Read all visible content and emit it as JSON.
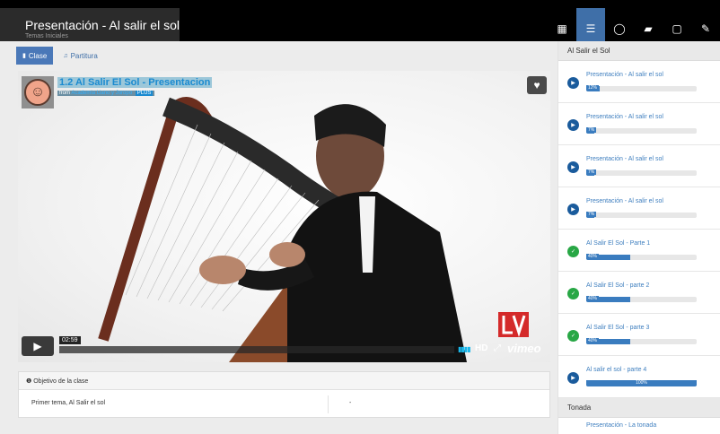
{
  "app": {
    "title": "Presentación - Al salir el sol",
    "subtitle": "Temas Iniciales"
  },
  "toolbar": {
    "icons": [
      "grid-icon",
      "list-icon",
      "chat-icon",
      "folder-icon",
      "note-icon",
      "wrench-icon"
    ],
    "active": "list-icon"
  },
  "tabs": [
    {
      "label": "Clase",
      "icon": "bookmark-icon",
      "active": true
    },
    {
      "label": "Partitura",
      "icon": "music-note-icon",
      "active": false
    }
  ],
  "video": {
    "title": "1.2 Al Salir El Sol - Presentacion",
    "from_prefix": "from",
    "channel": "Academia Llano y Joropo",
    "badge": "PLUS",
    "time": "02:59",
    "hd_label": "HD",
    "provider": "vimeo",
    "colors": {
      "accent": "#1ab7ea",
      "title": "#1a8ad0"
    }
  },
  "objective": {
    "heading": "Objetivo de la clase",
    "row_text": "Primer tema, Al Salir el sol",
    "row_value": "-"
  },
  "sidebar": {
    "section_1": "Al Salir el Sol",
    "items": [
      {
        "name": "Presentación - Al salir el sol",
        "progress_label": "12%",
        "progress": 0.12,
        "status": "play"
      },
      {
        "name": "Presentación - Al salir el sol",
        "progress_label": "7%",
        "progress": 0.07,
        "status": "play"
      },
      {
        "name": "Presentación - Al salir el sol",
        "progress_label": "7%",
        "progress": 0.07,
        "status": "play"
      },
      {
        "name": "Presentación - Al salir el sol",
        "progress_label": "7%",
        "progress": 0.07,
        "status": "play"
      },
      {
        "name": "Al Salir El Sol - Parte 1",
        "progress_label": "40%",
        "progress": 0.4,
        "status": "done"
      },
      {
        "name": "Al Salir El Sol - parte 2",
        "progress_label": "40%",
        "progress": 0.4,
        "status": "done"
      },
      {
        "name": "Al Salir El Sol - parte 3",
        "progress_label": "40%",
        "progress": 0.4,
        "status": "done"
      },
      {
        "name": "Al salir el sol - parte 4",
        "progress_label": "100%",
        "progress": 1.0,
        "status": "play"
      }
    ],
    "section_2": "Tonada",
    "peek_item": "Presentación - La tonada"
  }
}
